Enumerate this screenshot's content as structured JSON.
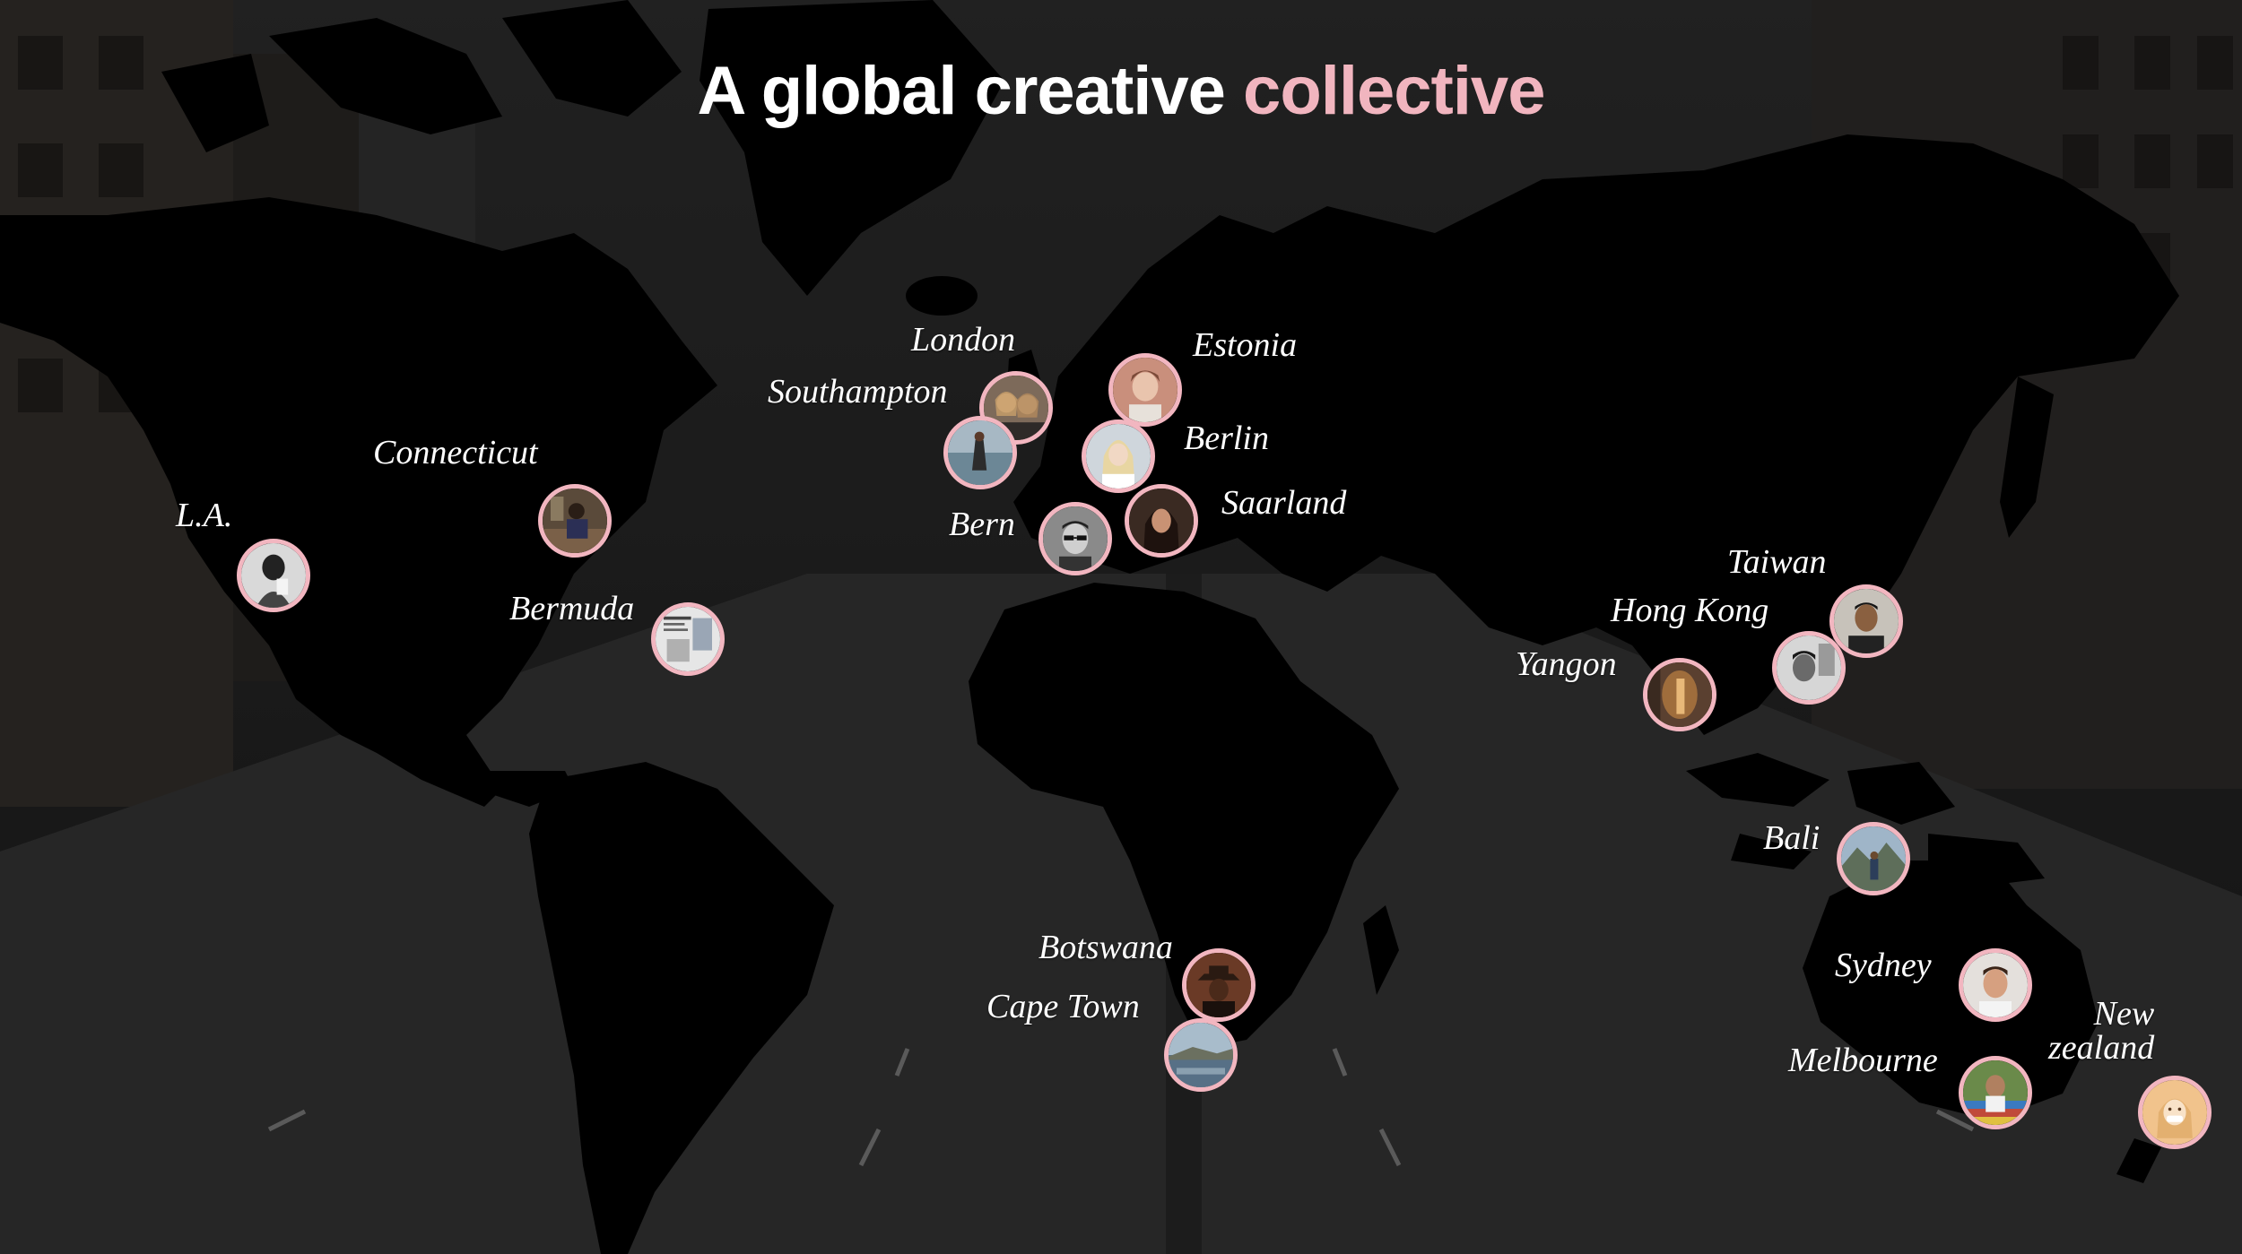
{
  "title": {
    "main": "A global creative",
    "accent": "collective"
  },
  "colors": {
    "accent": "#f1b5bf",
    "pin_border": "#f2b6c0",
    "map": "#000000"
  },
  "locations": [
    {
      "id": "la",
      "label": "L.A.",
      "photo": "woman-black-and-white"
    },
    {
      "id": "connecticut",
      "label": "Connecticut",
      "photo": "person-seated-indoors"
    },
    {
      "id": "bermuda",
      "label": "Bermuda",
      "photo": "magazine-cover"
    },
    {
      "id": "london",
      "label": "London",
      "photo": "two-women-smiling"
    },
    {
      "id": "southampton",
      "label": "Southampton",
      "photo": "person-by-water"
    },
    {
      "id": "estonia",
      "label": "Estonia",
      "photo": "woman-portrait"
    },
    {
      "id": "berlin",
      "label": "Berlin",
      "photo": "blonde-woman-portrait"
    },
    {
      "id": "saarland",
      "label": "Saarland",
      "photo": "dark-haired-woman"
    },
    {
      "id": "bern",
      "label": "Bern",
      "photo": "man-with-glasses"
    },
    {
      "id": "taiwan",
      "label": "Taiwan",
      "photo": "man-portrait"
    },
    {
      "id": "hong-kong",
      "label": "Hong Kong",
      "photo": "man-black-and-white"
    },
    {
      "id": "yangon",
      "label": "Yangon",
      "photo": "warm-lit-figure"
    },
    {
      "id": "bali",
      "label": "Bali",
      "photo": "person-mountains"
    },
    {
      "id": "botswana",
      "label": "Botswana",
      "photo": "person-with-hat"
    },
    {
      "id": "cape-town",
      "label": "Cape Town",
      "photo": "coastal-scene"
    },
    {
      "id": "sydney",
      "label": "Sydney",
      "photo": "smiling-man"
    },
    {
      "id": "melbourne",
      "label": "Melbourne",
      "photo": "person-colorful"
    },
    {
      "id": "new-zealand",
      "label": "New\nzealand",
      "photo": "illustrated-avatar"
    }
  ]
}
